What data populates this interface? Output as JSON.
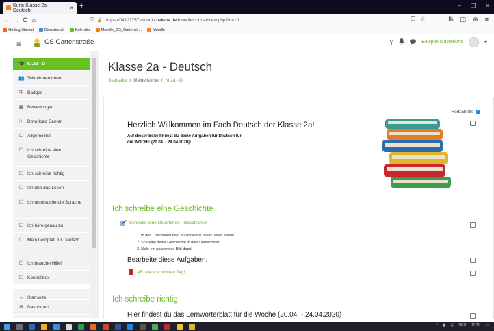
{
  "browser": {
    "tab_title": "Kurs: Klasse 2a - Deutsch",
    "tab_close": "×",
    "new_tab": "+",
    "window_controls": [
      "–",
      "❐",
      "✕"
    ],
    "nav": {
      "back": "←",
      "forward": "→",
      "reload": "C",
      "home": "⌂"
    },
    "url_prefix": "https://04121757.moodle.",
    "url_domain": "belwue.de",
    "url_path": "/moodle/course/view.php?id=10",
    "url_right_icons": [
      "···",
      "☐",
      "☆"
    ],
    "toolbar_icons": [
      "II\\",
      "◫",
      "⊕",
      "≡"
    ],
    "bookmarks": [
      {
        "label": "Getting Started",
        "color": "#e86a26"
      },
      {
        "label": "Dienstemail",
        "color": "#3d8fe0"
      },
      {
        "label": "Kalender",
        "color": "#69c024"
      },
      {
        "label": "Moodle_GS_Gartenstr...",
        "color": "#f98012"
      },
      {
        "label": "Moodle",
        "color": "#f98012"
      }
    ]
  },
  "header": {
    "menu_icon": "≡",
    "site_name": "GS Gartenstraße",
    "search_icon": "⚲",
    "bell_icon": "🔔",
    "chat_icon": "●",
    "user_name": "Beispiel Musterkind",
    "caret": "▾"
  },
  "sidebar": {
    "items": [
      {
        "icon": "🎓",
        "label": "Kl.2a - D",
        "active": true
      },
      {
        "icon": "👥",
        "label": "Teilnehmer/innen"
      },
      {
        "icon": "⛨",
        "label": "Badges"
      },
      {
        "icon": "▦",
        "label": "Bewertungen"
      },
      {
        "icon": "⦿",
        "label": "Download Center"
      },
      {
        "icon": "☐",
        "label": "Allgemeines"
      },
      {
        "icon": "☐",
        "label": "Ich schreibe eine Geschichte"
      },
      {
        "icon": "☐",
        "label": "Ich schreibe richtig"
      },
      {
        "icon": "☐",
        "label": "Ich übe das Lesen"
      },
      {
        "icon": "☐",
        "label": "Ich untersuche die Sprache"
      },
      {
        "icon": "☐",
        "label": "Ich höre genau zu"
      },
      {
        "icon": "☐",
        "label": "Mein Lernplan für Deutsch"
      },
      {
        "icon": "☐",
        "label": "Ich brauche Hilfe!"
      },
      {
        "icon": "☐",
        "label": "Kontrollbox"
      },
      {
        "icon": "⌂",
        "label": "Startseite"
      },
      {
        "icon": "⚙",
        "label": "Dashboard"
      }
    ]
  },
  "main": {
    "title": "Klasse 2a - Deutsch",
    "breadcrumb": [
      "Startseite",
      "Meine Kurse",
      "Kl.2a - D"
    ],
    "breadcrumb_sep": "/",
    "progress_label": "Fortschritte",
    "progress_help": "?",
    "welcome_heading": "Herzlich Willkommen im Fach Deutsch der Klasse 2a!",
    "intro_line1": "Auf dieser Seite findest du deine Aufgaben für Deutsch für",
    "intro_line2": "die WOCHE (20.04. - 24.04.2020)!",
    "section1": {
      "title": "Ich schreibe eine Geschichte",
      "activity": "Schreibe eine Osterferien - Geschichte!",
      "steps": [
        "1. In den Osterferien hast du sicherlich etwas Tolles erlebt!",
        "2. Schreibe deine Geschichte in dein Deutschheft.",
        "3. Male ein passendes Bild dazu!"
      ],
      "task_text": "Bearbeite diese Aufgaben.",
      "worksheet": "AB: Mein schönster Tag!"
    },
    "section2": {
      "title": "Ich schreibe richtig",
      "text": "Hier findest du das Lernwörterblatt für die Woche (20.04. - 24.04.2020)"
    }
  },
  "taskbar": {
    "tray_text": "DEU",
    "time": "11:21"
  }
}
